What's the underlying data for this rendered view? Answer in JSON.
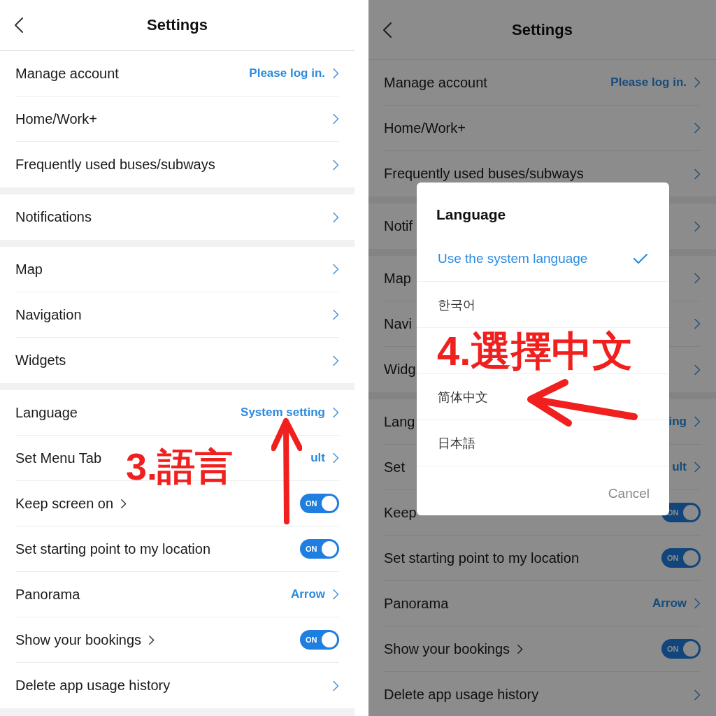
{
  "panels": [
    {
      "header": {
        "title": "Settings"
      },
      "dimmed": false,
      "sections": [
        {
          "rows": [
            {
              "kind": "link",
              "label": "Manage account",
              "value": "Please log in."
            },
            {
              "kind": "link",
              "label": "Home/Work+"
            },
            {
              "kind": "link",
              "label": "Frequently used buses/subways"
            }
          ]
        },
        {
          "rows": [
            {
              "kind": "link",
              "label": "Notifications"
            }
          ]
        },
        {
          "rows": [
            {
              "kind": "link",
              "label": "Map"
            },
            {
              "kind": "link",
              "label": "Navigation"
            },
            {
              "kind": "link",
              "label": "Widgets"
            }
          ]
        },
        {
          "rows": [
            {
              "kind": "link",
              "label": "Language",
              "value": "System setting"
            },
            {
              "kind": "link",
              "label": "Set Menu Tab",
              "value": "ult"
            },
            {
              "kind": "toggle",
              "label": "Keep screen on",
              "chevron_after_label": true,
              "on": true,
              "toggle_text": "ON"
            },
            {
              "kind": "toggle",
              "label": "Set starting point to my location",
              "on": true,
              "toggle_text": "ON"
            },
            {
              "kind": "link",
              "label": "Panorama",
              "value": "Arrow"
            },
            {
              "kind": "toggle",
              "label": "Show your bookings",
              "chevron_after_label": true,
              "on": true,
              "toggle_text": "ON"
            },
            {
              "kind": "link",
              "label": "Delete app usage history"
            }
          ]
        }
      ],
      "annotation": {
        "text": "3.語言",
        "kind": "up"
      }
    },
    {
      "header": {
        "title": "Settings"
      },
      "dimmed": true,
      "sections": [
        {
          "rows": [
            {
              "kind": "link",
              "label": "Manage account",
              "value": "Please log in."
            },
            {
              "kind": "link",
              "label": "Home/Work+"
            },
            {
              "kind": "link",
              "label": "Frequently used buses/subways"
            }
          ]
        },
        {
          "rows": [
            {
              "kind": "link",
              "label": "Notif"
            }
          ]
        },
        {
          "rows": [
            {
              "kind": "link",
              "label": "Map"
            },
            {
              "kind": "link",
              "label": "Navi"
            },
            {
              "kind": "link",
              "label": "Widg"
            }
          ]
        },
        {
          "rows": [
            {
              "kind": "link",
              "label": "Lang",
              "value": "ing"
            },
            {
              "kind": "link",
              "label": "Set",
              "value": "ult"
            },
            {
              "kind": "toggle",
              "label": "Keep",
              "on": true,
              "toggle_text": "ON"
            },
            {
              "kind": "toggle",
              "label": "Set starting point to my location",
              "on": true,
              "toggle_text": "ON"
            },
            {
              "kind": "link",
              "label": "Panorama",
              "value": "Arrow"
            },
            {
              "kind": "toggle",
              "label": "Show your bookings",
              "chevron_after_label": true,
              "on": true,
              "toggle_text": "ON"
            },
            {
              "kind": "link",
              "label": "Delete app usage history"
            }
          ]
        }
      ],
      "dialog": {
        "title": "Language",
        "rows": [
          {
            "kind": "option",
            "label": "Use the system language",
            "selected": true
          },
          {
            "kind": "option",
            "label": "한국어",
            "selected": false
          },
          {
            "kind": "annotation",
            "text": "4.選擇中文"
          },
          {
            "kind": "option",
            "label": "简体中文",
            "selected": false
          },
          {
            "kind": "option",
            "label": "日本語",
            "selected": false
          }
        ],
        "cancel": "Cancel"
      }
    }
  ]
}
